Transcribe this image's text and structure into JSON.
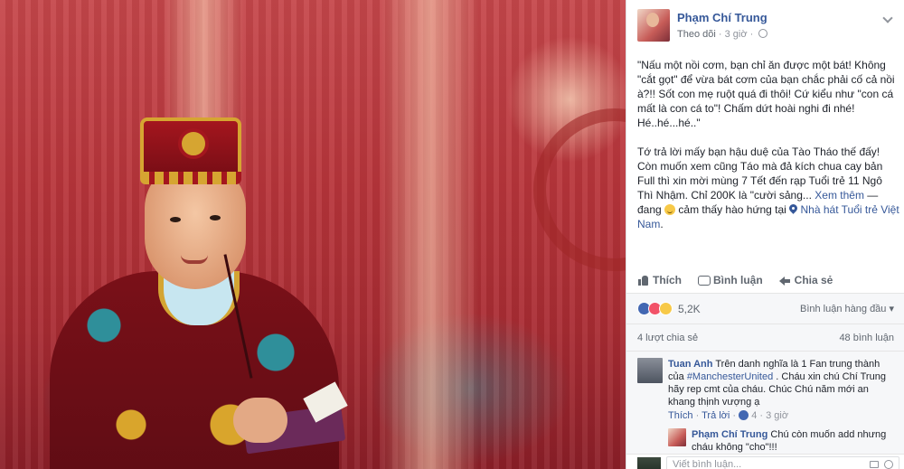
{
  "post": {
    "author": "Phạm Chí Trung",
    "follow_label": "Theo dõi",
    "time": "3 giờ",
    "paragraph1": "\"Nấu một nồi cơm, bạn chỉ ăn được một bát! Không \"cắt gọt\" để vừa bát cơm của bạn chắc phải cố cả nồi à?!! Sốt con mẹ ruột quá đi thôi! Cứ kiểu như \"con cá mất là con cá to\"! Chấm dứt hoài nghi đi nhé! Hé..hé...hé..\"",
    "paragraph2_text": "Tớ trả lời mấy bạn hậu duệ của Tào Tháo thế đấy! Còn muốn xem cũng Táo mà đả kích chua cay bản Full thì xin mời mùng 7 Tết đến rạp Tuổi trẻ 11 Ngô Thì Nhậm. Chỉ 200K là \"cười sảng...",
    "see_more": "Xem thêm",
    "feeling_prefix": "— đang",
    "feeling_text": "cảm thấy hào hứng tại",
    "location": "Nhà hát Tuổi trẻ Việt Nam",
    "location_end": "."
  },
  "actions": {
    "like": "Thích",
    "comment": "Bình luận",
    "share": "Chia sẻ"
  },
  "reactions": {
    "count": "5,2K",
    "sort_label": "Bình luận hàng đầu"
  },
  "stats": {
    "shares": "4 lượt chia sẻ",
    "comments": "48 bình luận"
  },
  "comments": [
    {
      "name": "Tuan Anh",
      "text_before": "Trên danh nghĩa là 1 Fan trung thành của",
      "hashtag": "#ManchesterUnited",
      "text_after": ". Cháu xin chú Chí Trung hãy rep cmt của cháu. Chúc Chú năm mới an khang thịnh vượng ạ",
      "like_label": "Thích",
      "reply_label": "Trả lời",
      "likes": "4",
      "time": "3 giờ"
    },
    {
      "name": "Phạm Chí Trung",
      "text": "Chú còn muốn add nhưng cháu không \"cho\"!!!"
    }
  ],
  "input": {
    "placeholder": "Viết bình luận..."
  }
}
